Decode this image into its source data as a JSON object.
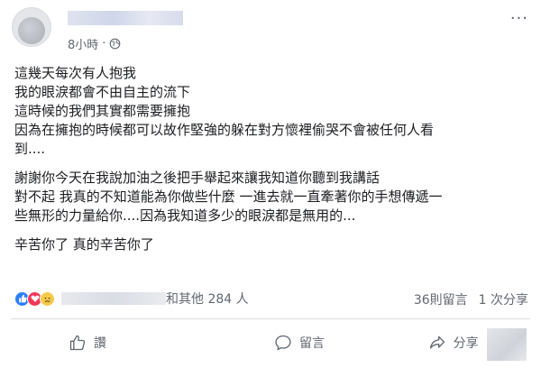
{
  "post": {
    "time": "8小時",
    "more_label": "···",
    "paragraphs": [
      {
        "lines": [
          "這幾天每次有人抱我",
          "我的眼淚都會不由自主的流下",
          "這時候的我們其實都需要擁抱",
          "因為在擁抱的時候都可以故作堅強的躲在對方懷裡偷哭不會被任何人看",
          "到...."
        ]
      },
      {
        "lines": [
          "謝謝你今天在我說加油之後把手舉起來讓我知道你聽到我講話",
          "對不起 我真的不知道能為你做些什麼 一進去就一直牽著你的手想傳遞一",
          "些無形的力量給你....因為我知道多少的眼淚都是無用的..."
        ]
      },
      {
        "lines": [
          "辛苦你了 真的辛苦你了"
        ]
      }
    ]
  },
  "reactions": {
    "icons": [
      "like-reaction-icon",
      "love-reaction-icon",
      "sad-reaction-icon"
    ],
    "others_text": "和其他 284 人",
    "comments": "36則留言",
    "shares": "1 次分享"
  },
  "actions": {
    "like": "讚",
    "comment": "留言",
    "share": "分享"
  },
  "colors": {
    "like_blue": "#2d7ff9",
    "love_red": "#f0385a",
    "sad_yellow": "#f7c94a",
    "secondary_text": "#606770"
  }
}
